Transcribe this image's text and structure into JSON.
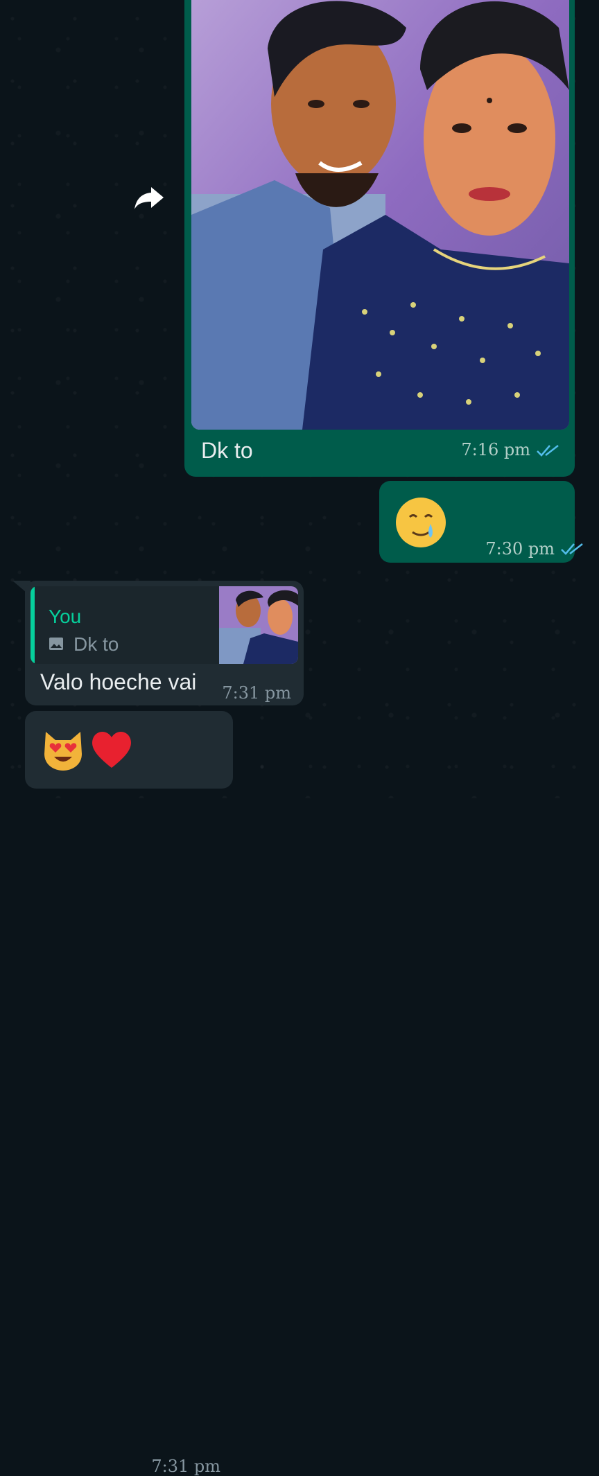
{
  "messages": {
    "photo": {
      "caption": "Dk to",
      "time": "7:16 pm",
      "status": "read"
    },
    "emoji_reply": {
      "emoji": "🥲",
      "time": "7:30 pm",
      "status": "read"
    },
    "quoted_reply": {
      "quote_author": "You",
      "quote_text": "Dk to",
      "text": "Valo hoeche vai",
      "time": "7:31 pm"
    },
    "emoji_message": {
      "emoji": "😻❤️",
      "time": "7:31 pm"
    }
  },
  "colors": {
    "outgoing_bubble": "#005c4b",
    "incoming_bubble": "#202c33",
    "read_ticks": "#53bdeb",
    "quote_accent": "#06cf9c"
  },
  "icons": [
    "forward-icon",
    "double-check-icon",
    "image-icon"
  ]
}
